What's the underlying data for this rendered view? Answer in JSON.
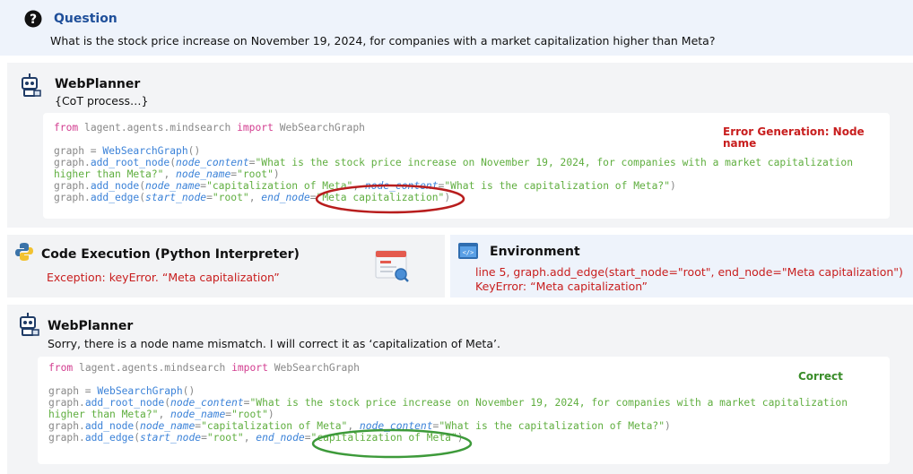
{
  "question": {
    "title": "Question",
    "text": "What is the stock price increase on November 19, 2024, for companies with a market capitalization higher than Meta?"
  },
  "planner1": {
    "title": "WebPlanner",
    "subtitle": "{CoT process…}",
    "error_label": "Error Generation: Node name",
    "code": {
      "import_from": "from",
      "import_module": "lagent.agents.mindsearch",
      "import_kw": "import",
      "import_name": "WebSearchGraph",
      "graph_var": "graph = ",
      "graph_ctor": "WebSearchGraph",
      "graph_paren": "()",
      "root_prefix": "graph.",
      "root_fn": "add_root_node",
      "root_open": "(",
      "node_content_kw": "node_content",
      "eq": "=",
      "root_content_a": "\"What is the stock price increase on November 19, 2024, for companies with a market capitalization",
      "root_content_b": "higher than Meta?\"",
      "comma": ", ",
      "node_name_kw": "node_name",
      "root_name": "\"root\"",
      "close": ")",
      "add_node_fn": "add_node",
      "node_name_val": "\"capitalization of Meta\"",
      "node_content_val": "\"What is the capitalization of Meta?\"",
      "add_edge_fn": "add_edge",
      "start_node_kw": "start_node",
      "end_node_kw": "end_node",
      "end_node_val": "\"Meta capitalization\""
    }
  },
  "execution": {
    "title": "Code Execution (Python Interpreter)",
    "exception": "Exception: keyError. “Meta capitalization”"
  },
  "environment": {
    "title": "Environment",
    "line1": "line 5, graph.add_edge(start_node=\"root\", end_node=\"Meta capitalization\")",
    "line2": "KeyError: “Meta capitalization”"
  },
  "planner2": {
    "title": "WebPlanner",
    "subtitle": "Sorry, there is a node name mismatch. I will correct it as ‘capitalization of Meta’.",
    "correct_label": "Correct",
    "end_node_val": "\"capitalization of Meta\""
  },
  "colors": {
    "keyword": "#d23c8f",
    "function": "#3b82d8",
    "string": "#5fae3f",
    "error": "#c81e1e",
    "correct": "#3a8d2a"
  }
}
